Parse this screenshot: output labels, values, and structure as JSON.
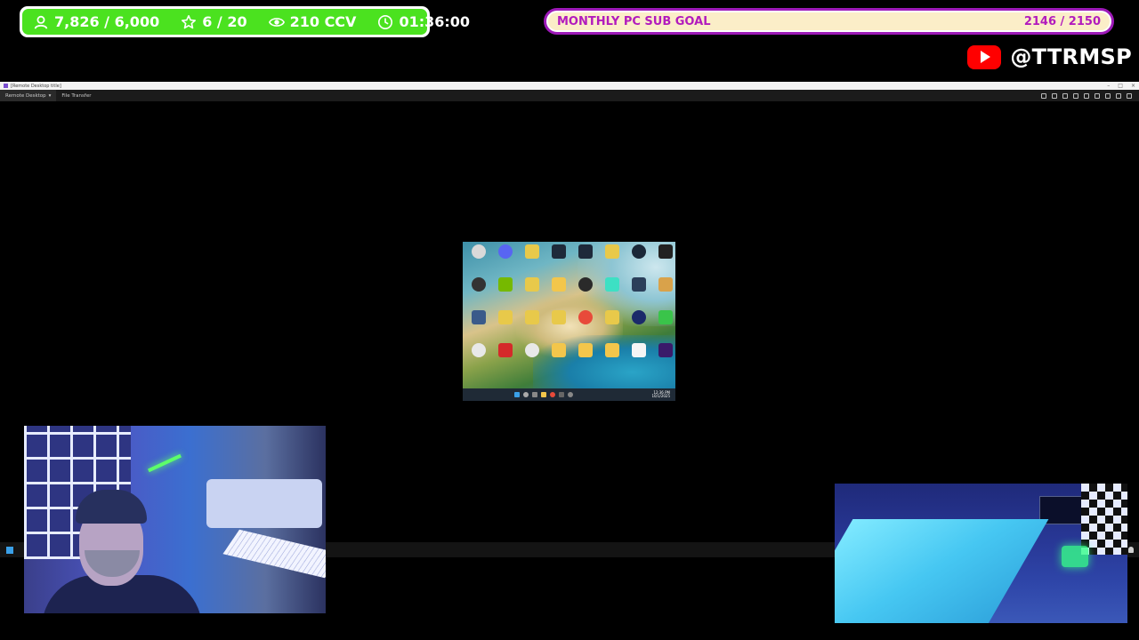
{
  "stats": {
    "followers": "7,826 / 6,000",
    "subs": "6 / 20",
    "viewers": "210 CCV",
    "uptime": "01:36:00"
  },
  "goal": {
    "label": "MONTHLY PC SUB GOAL",
    "count": "2146 / 2150",
    "progress": 0.998,
    "fill_color": "#fbeec8",
    "border_color": "#9d19b8",
    "text_color": "#b21bbd"
  },
  "youtube": {
    "handle": "@TTRMSP"
  },
  "remote_window": {
    "title": "[Remote Desktop title]",
    "tabs": [
      "Remote Desktop",
      "File Transfer"
    ]
  },
  "remote_desktop": {
    "taskbar_time": "12:36 PM",
    "taskbar_date": "10/1/2025"
  },
  "colors": {
    "stat_bar": "#4be21f",
    "youtube_red": "#ff0000"
  }
}
